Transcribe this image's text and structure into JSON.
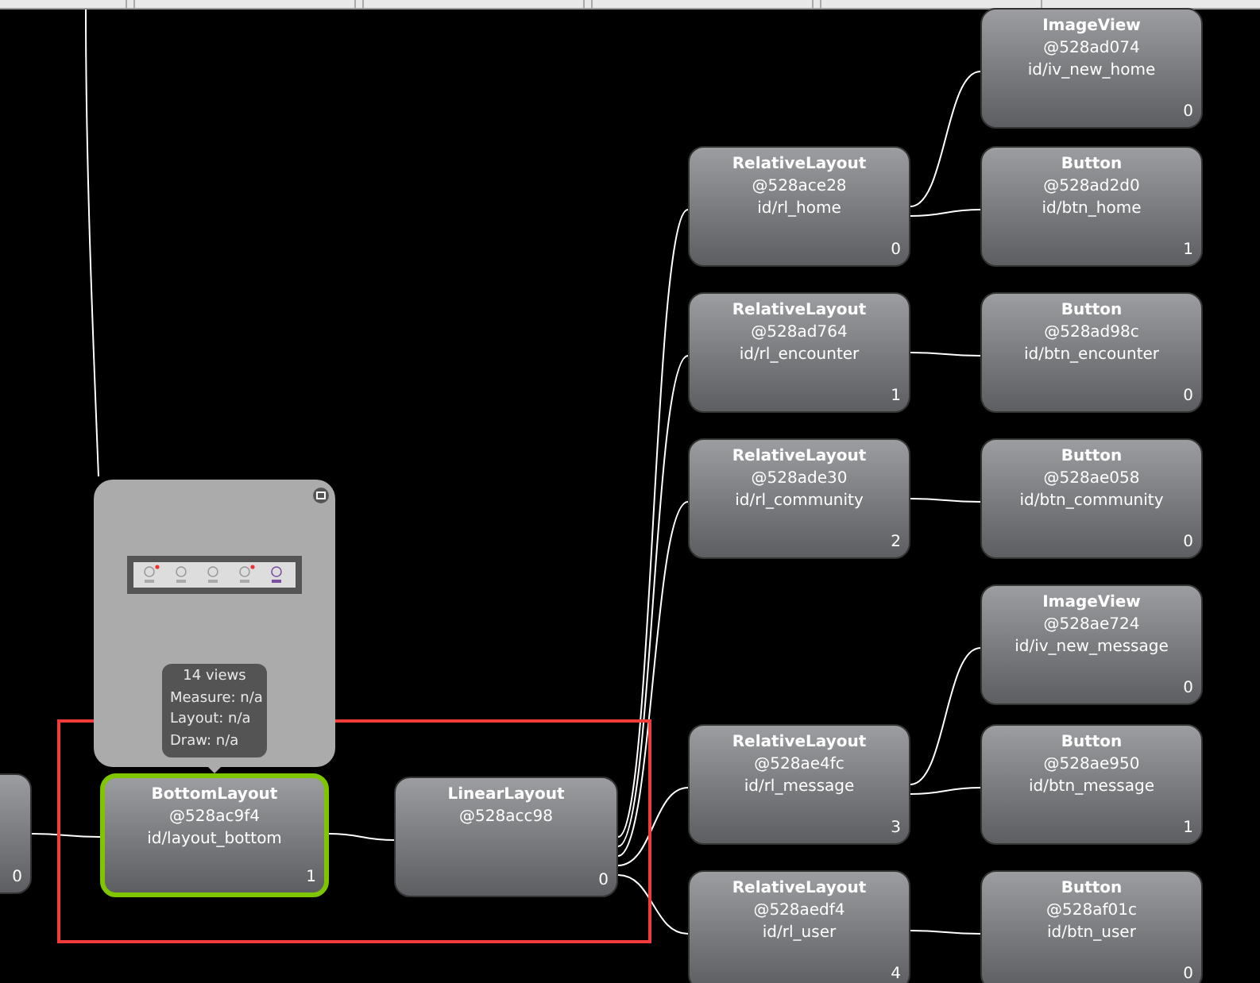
{
  "tree": {
    "index": "0",
    "selected": false,
    "children": [
      {
        "name": "BottomLayout",
        "address": "@528ac9f4",
        "id": "id/layout_bottom",
        "index": "1",
        "selected": true,
        "children": [
          {
            "name": "LinearLayout",
            "address": "@528acc98",
            "index": "0",
            "selected": false,
            "children": [
              {
                "name": "RelativeLayout",
                "address": "@528ace28",
                "id": "id/rl_home",
                "index": "0",
                "selected": false,
                "children": [
                  {
                    "name": "ImageView",
                    "address": "@528ad074",
                    "id": "id/iv_new_home",
                    "index": "0",
                    "selected": false
                  },
                  {
                    "name": "Button",
                    "address": "@528ad2d0",
                    "id": "id/btn_home",
                    "index": "1",
                    "selected": false
                  }
                ]
              },
              {
                "name": "RelativeLayout",
                "address": "@528ad764",
                "id": "id/rl_encounter",
                "index": "1",
                "selected": false,
                "children": [
                  {
                    "name": "Button",
                    "address": "@528ad98c",
                    "id": "id/btn_encounter",
                    "index": "0",
                    "selected": false
                  }
                ]
              },
              {
                "name": "RelativeLayout",
                "address": "@528ade30",
                "id": "id/rl_community",
                "index": "2",
                "selected": false,
                "children": [
                  {
                    "name": "Button",
                    "address": "@528ae058",
                    "id": "id/btn_community",
                    "index": "0",
                    "selected": false
                  }
                ]
              },
              {
                "name": "RelativeLayout",
                "address": "@528ae4fc",
                "id": "id/rl_message",
                "index": "3",
                "selected": false,
                "children": [
                  {
                    "name": "ImageView",
                    "address": "@528ae724",
                    "id": "id/iv_new_message",
                    "index": "0",
                    "selected": false
                  },
                  {
                    "name": "Button",
                    "address": "@528ae950",
                    "id": "id/btn_message",
                    "index": "1",
                    "selected": false
                  }
                ]
              },
              {
                "name": "RelativeLayout",
                "address": "@528aedf4",
                "id": "id/rl_user",
                "index": "4",
                "selected": false,
                "children": [
                  {
                    "name": "Button",
                    "address": "@528af01c",
                    "id": "id/btn_user",
                    "index": "0",
                    "selected": false
                  }
                ]
              }
            ]
          }
        ]
      }
    ]
  },
  "preview": {
    "stats": [
      "14 views",
      "Measure: n/a",
      "Layout: n/a",
      "Draw: n/a"
    ]
  }
}
